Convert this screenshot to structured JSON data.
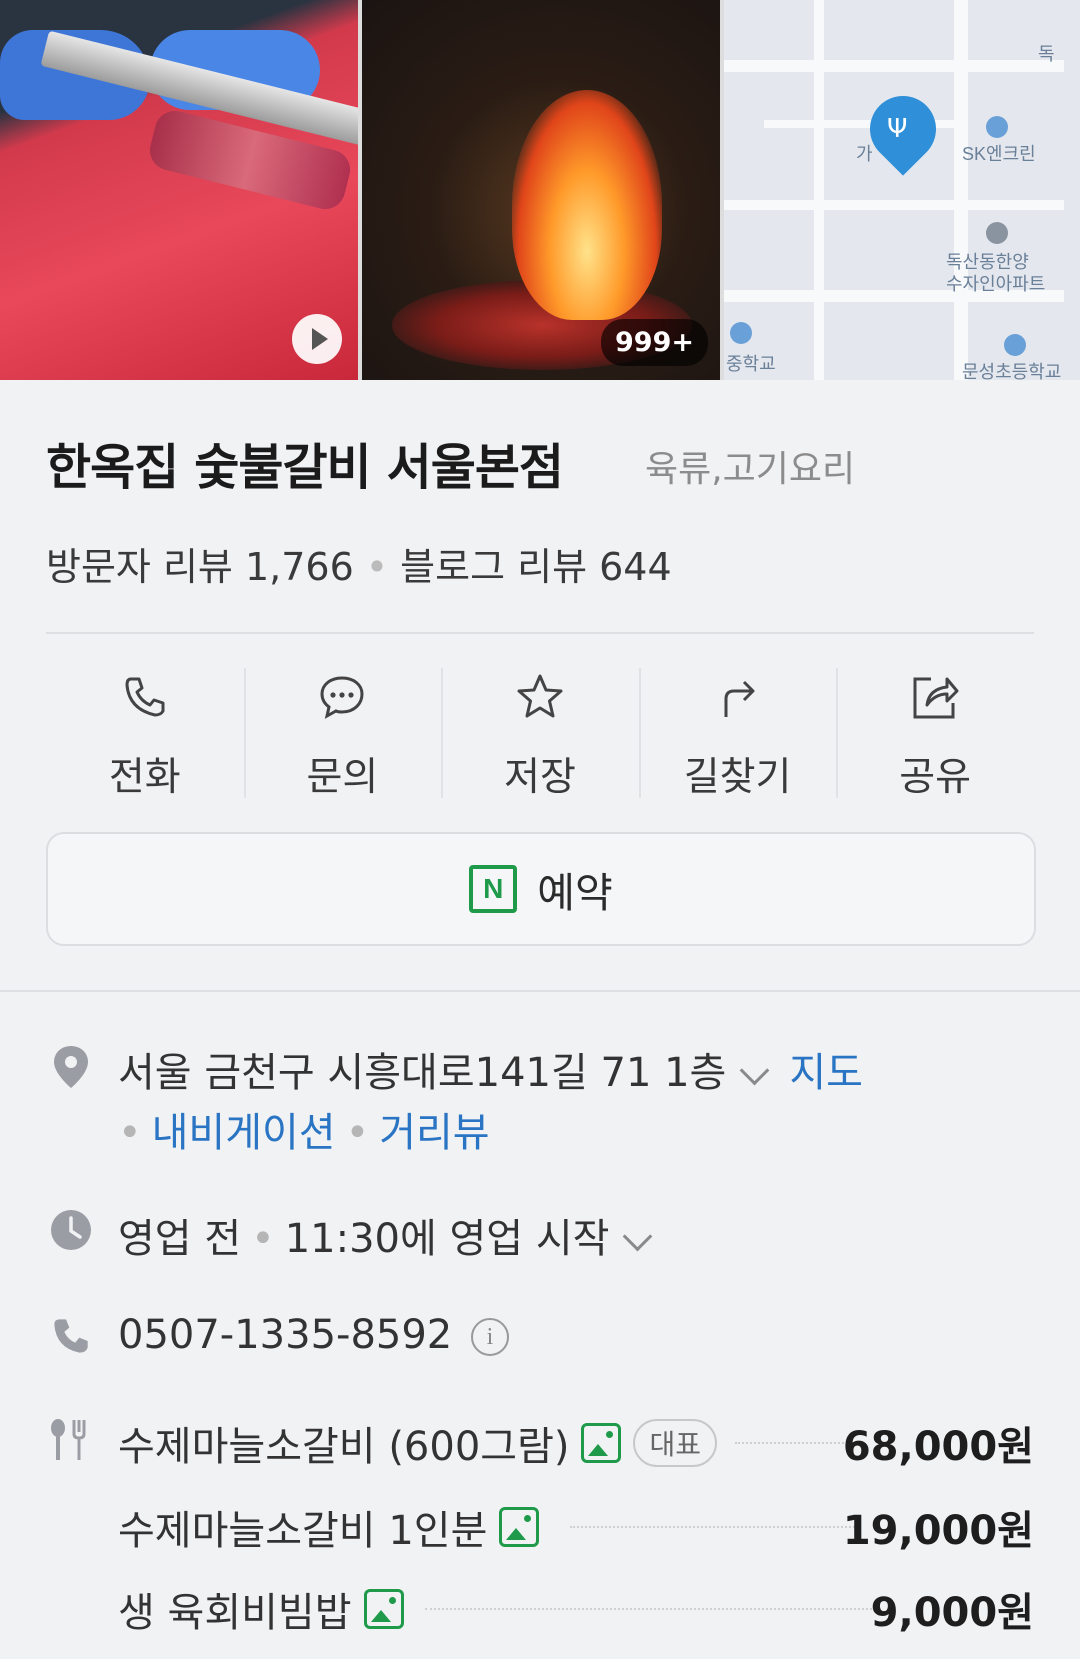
{
  "photos": {
    "count_badge": "999+"
  },
  "map": {
    "labels": [
      "SK엔크린",
      "독산동한양",
      "수자인아파트",
      "중학교",
      "문성초등학교",
      "가",
      "독"
    ]
  },
  "place": {
    "name": "한옥집 숯불갈비 서울본점",
    "category": "육류,고기요리",
    "visitor_reviews": "방문자 리뷰 1,766",
    "blog_reviews": "블로그 리뷰 644"
  },
  "actions": [
    {
      "label": "전화",
      "icon": "phone-icon"
    },
    {
      "label": "문의",
      "icon": "chat-icon"
    },
    {
      "label": "저장",
      "icon": "star-icon"
    },
    {
      "label": "길찾기",
      "icon": "directions-icon"
    },
    {
      "label": "공유",
      "icon": "share-icon"
    }
  ],
  "reserve": {
    "label": "예약",
    "icon_letter": "N"
  },
  "address": {
    "text": "서울 금천구 시흥대로141길 71 1층",
    "map_link": "지도",
    "nav_link": "내비게이션",
    "street_link": "거리뷰"
  },
  "hours": {
    "status": "영업 전",
    "detail": "11:30에 영업 시작"
  },
  "phone": {
    "number": "0507-1335-8592",
    "info": "i"
  },
  "menu": [
    {
      "name": "수제마늘소갈비 (600그람)",
      "tag": "대표",
      "price": "68,000원"
    },
    {
      "name": "수제마늘소갈비 1인분",
      "price": "19,000원"
    },
    {
      "name": "생 육회비빔밥",
      "price": "9,000원"
    }
  ],
  "colors": {
    "link": "#2a74c4",
    "accent_green": "#1f9a4a",
    "pin": "#2f8fd8"
  }
}
